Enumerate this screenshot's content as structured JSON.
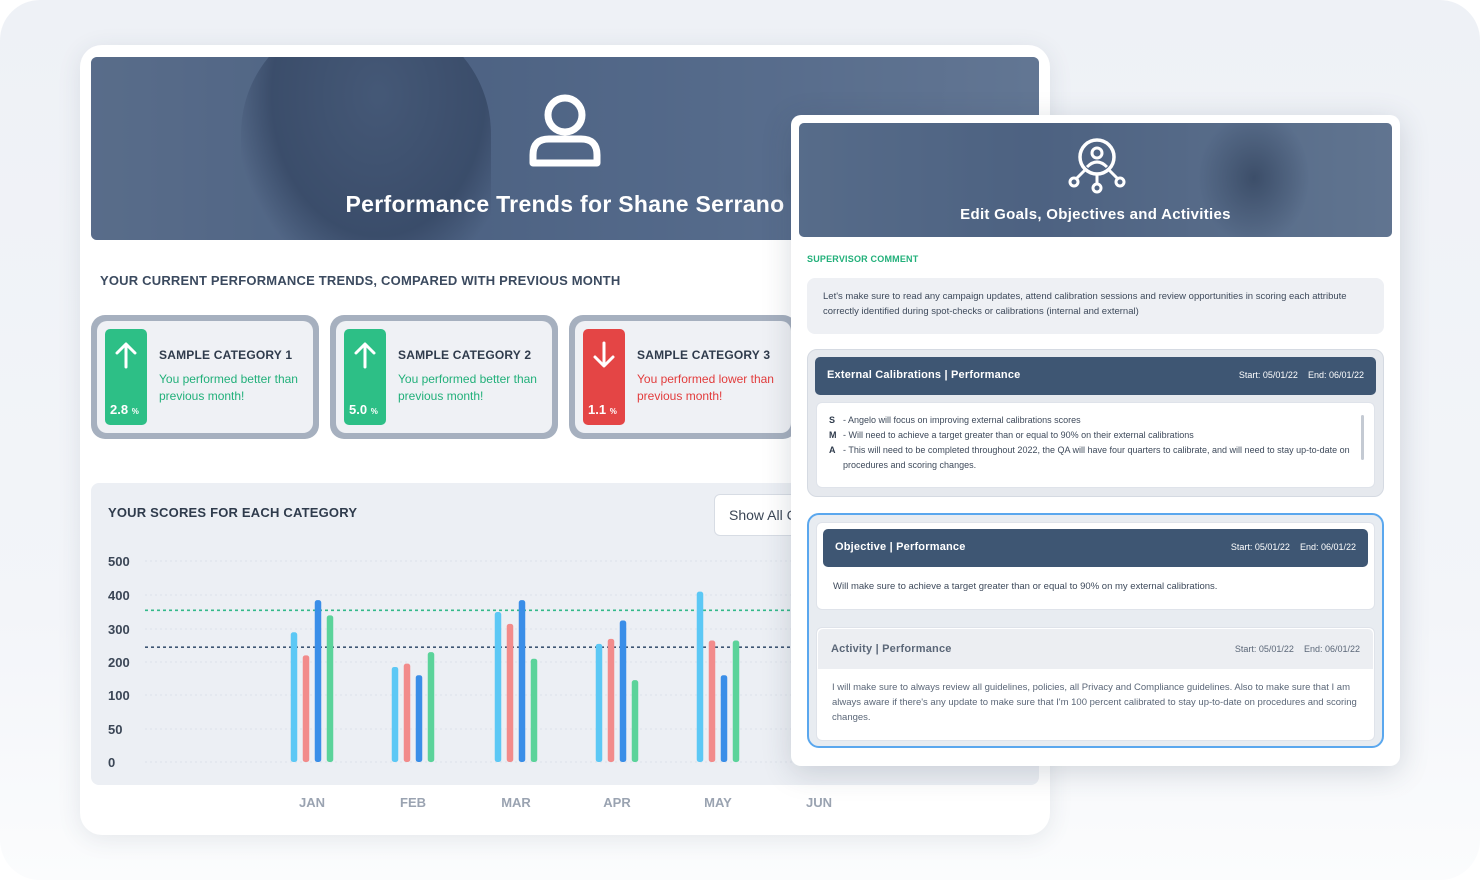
{
  "main": {
    "hero_title": "Performance Trends for Shane Serrano",
    "section_title": "YOUR CURRENT PERFORMANCE TRENDS, COMPARED WITH PREVIOUS MONTH",
    "trends": [
      {
        "name": "SAMPLE CATEGORY 1",
        "value": "2.8",
        "unit": "%",
        "direction": "up",
        "message": "You performed better than previous month!"
      },
      {
        "name": "SAMPLE CATEGORY 2",
        "value": "5.0",
        "unit": "%",
        "direction": "up",
        "message": "You performed better than previous month!"
      },
      {
        "name": "SAMPLE CATEGORY 3",
        "value": "1.1",
        "unit": "%",
        "direction": "down",
        "message": "You performed lower than previous month!"
      }
    ],
    "chart_title": "YOUR SCORES FOR EACH CATEGORY",
    "show_all_label": "Show All C"
  },
  "chart_data": {
    "type": "bar",
    "categories": [
      "JAN",
      "FEB",
      "MAR",
      "APR",
      "MAY",
      "JUN"
    ],
    "series": [
      {
        "values": [
          290,
          185,
          350,
          255,
          410,
          null
        ]
      },
      {
        "values": [
          220,
          195,
          315,
          270,
          265,
          null
        ]
      },
      {
        "values": [
          385,
          160,
          385,
          325,
          160,
          null
        ]
      },
      {
        "values": [
          340,
          230,
          210,
          145,
          265,
          null
        ]
      }
    ],
    "series_colors": [
      "#5cc8f5",
      "#f28b8b",
      "#3a8ee8",
      "#5bd39a"
    ],
    "y_ticks": [
      "500",
      "400",
      "300",
      "200",
      "100",
      "50",
      "0"
    ],
    "y_tick_values": [
      500,
      400,
      300,
      200,
      100,
      50,
      0
    ],
    "reference_lines": [
      {
        "value": 355,
        "color": "#33b98a"
      },
      {
        "value": 245,
        "color": "#3e5673"
      }
    ],
    "grid": true
  },
  "goals": {
    "title": "Edit Goals, Objectives and Activities",
    "supervisor_label": "SUPERVISOR COMMENT",
    "supervisor_comment": "Let's make sure to read any campaign updates, attend calibration sessions and review opportunities in scoring each attribute correctly identified during spot-checks or calibrations (internal and external)",
    "external": {
      "label": "External Calibrations | Performance",
      "start": "Start: 05/01/22",
      "end": "End: 06/01/22",
      "items": [
        {
          "key": "S",
          "text": "- Angelo will focus on improving external calibrations scores"
        },
        {
          "key": "M",
          "text": "- Will need to achieve a target greater than or equal to 90% on their external calibrations"
        },
        {
          "key": "A",
          "text": "- This will need to be completed throughout 2022, the QA will have four quarters to calibrate, and will need to stay up-to-date on procedures and scoring changes."
        }
      ]
    },
    "objective": {
      "label": "Objective | Performance",
      "start": "Start: 05/01/22",
      "end": "End: 06/01/22",
      "text": "Will make sure to achieve a target greater than or equal to 90% on my external calibrations."
    },
    "activity": {
      "label": "Activity | Performance",
      "start": "Start: 05/01/22",
      "end": "End: 06/01/22",
      "text": "I will make sure to always review all guidelines, policies, all Privacy and Compliance guidelines. Also to make sure that I am always aware if there's any update to make sure that I'm 100 percent calibrated to stay up-to-date on procedures and scoring changes."
    }
  },
  "icons": {
    "hero": "user-outline-icon",
    "goals": "goal-network-icon",
    "trend_up": "arrow-up-icon",
    "trend_down": "arrow-down-icon"
  },
  "colors": {
    "positive": "#2dbf86",
    "negative": "#e44545",
    "header_bar": "#3e5673",
    "selected_border": "#5aa7ee"
  }
}
